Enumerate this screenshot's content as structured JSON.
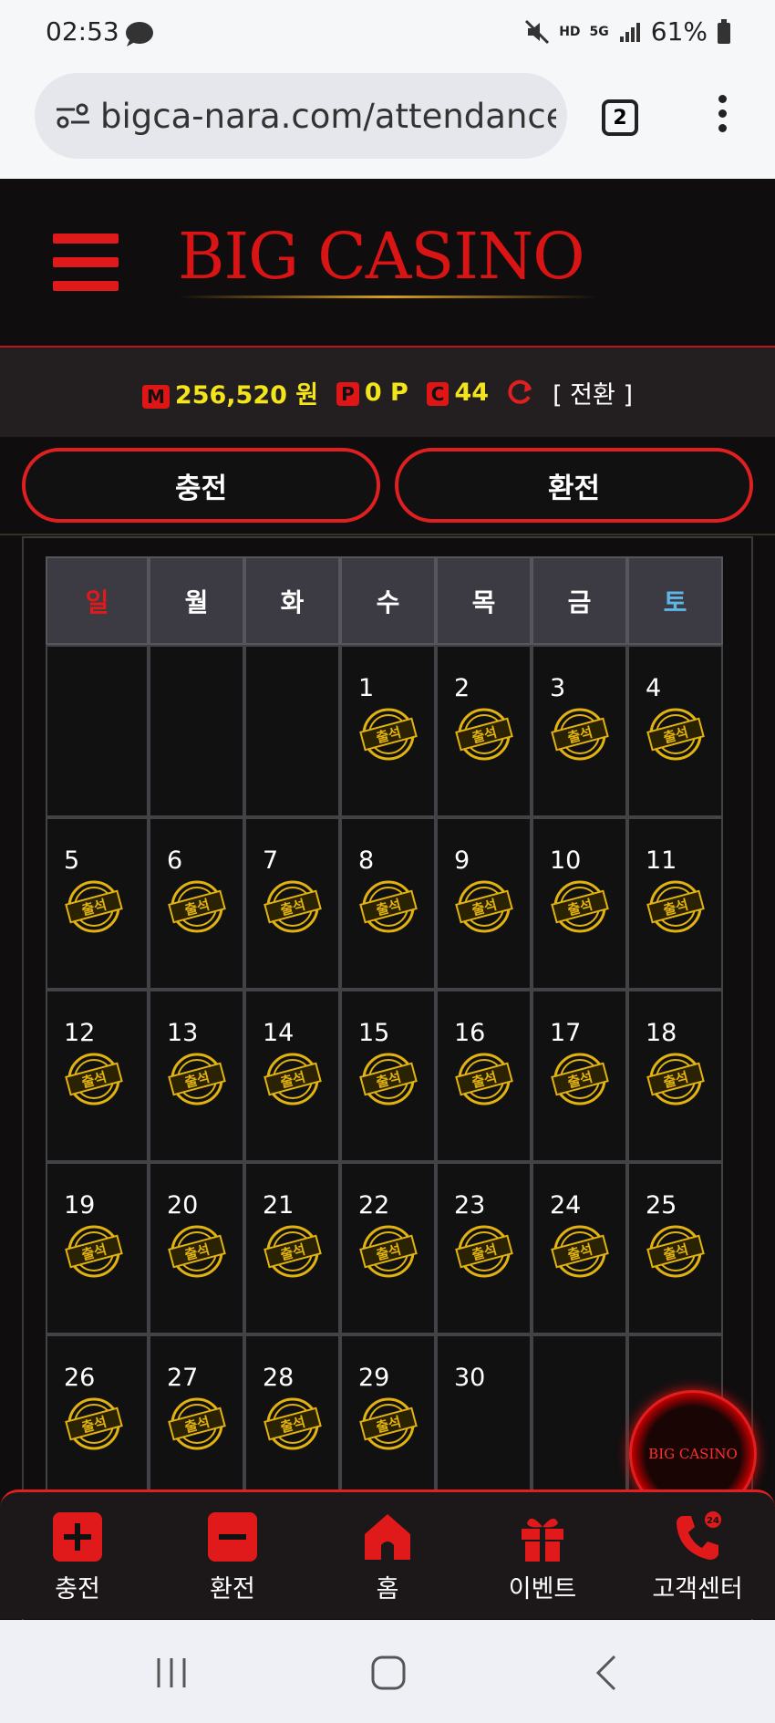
{
  "status_bar": {
    "time": "02:53",
    "battery": "61%",
    "network": "5G",
    "hd_label": "HD"
  },
  "browser": {
    "url": "bigca-nara.com/attendance2",
    "tab_count": "2"
  },
  "site": {
    "logo": "BIG CASINO",
    "balance": {
      "money_badge": "M",
      "money": "256,520 원",
      "point_badge": "P",
      "point": "0 P",
      "comp_badge": "C",
      "comp": "44",
      "convert": "[ 전환 ]"
    },
    "buttons": {
      "charge": "충전",
      "exchange": "환전"
    },
    "calendar": {
      "weekdays": [
        "일",
        "월",
        "화",
        "수",
        "목",
        "금",
        "토"
      ],
      "weekday_colors": {
        "sun": "#e01a1a",
        "sat": "#5fb6e6",
        "default": "#ffffff"
      },
      "stamp_label": "출석",
      "weeks": [
        [
          {
            "day": ""
          },
          {
            "day": ""
          },
          {
            "day": ""
          },
          {
            "day": "1",
            "stamp": true
          },
          {
            "day": "2",
            "stamp": true
          },
          {
            "day": "3",
            "stamp": true
          },
          {
            "day": "4",
            "stamp": true
          }
        ],
        [
          {
            "day": "5",
            "stamp": true
          },
          {
            "day": "6",
            "stamp": true
          },
          {
            "day": "7",
            "stamp": true
          },
          {
            "day": "8",
            "stamp": true
          },
          {
            "day": "9",
            "stamp": true
          },
          {
            "day": "10",
            "stamp": true
          },
          {
            "day": "11",
            "stamp": true
          }
        ],
        [
          {
            "day": "12",
            "stamp": true
          },
          {
            "day": "13",
            "stamp": true
          },
          {
            "day": "14",
            "stamp": true
          },
          {
            "day": "15",
            "stamp": true
          },
          {
            "day": "16",
            "stamp": true
          },
          {
            "day": "17",
            "stamp": true
          },
          {
            "day": "18",
            "stamp": true
          }
        ],
        [
          {
            "day": "19",
            "stamp": true
          },
          {
            "day": "20",
            "stamp": true
          },
          {
            "day": "21",
            "stamp": true
          },
          {
            "day": "22",
            "stamp": true
          },
          {
            "day": "23",
            "stamp": true
          },
          {
            "day": "24",
            "stamp": true
          },
          {
            "day": "25",
            "stamp": true
          }
        ],
        [
          {
            "day": "26",
            "stamp": true
          },
          {
            "day": "27",
            "stamp": true
          },
          {
            "day": "28",
            "stamp": true
          },
          {
            "day": "29",
            "stamp": true
          },
          {
            "day": "30",
            "stamp": false
          },
          {
            "day": ""
          },
          {
            "day": ""
          }
        ]
      ]
    },
    "floating_logo": "BIG CASINO",
    "bottom_nav": [
      {
        "label": "충전",
        "icon": "plus-icon"
      },
      {
        "label": "환전",
        "icon": "minus-icon"
      },
      {
        "label": "홈",
        "icon": "home-icon"
      },
      {
        "label": "이벤트",
        "icon": "gift-icon"
      },
      {
        "label": "고객센터",
        "icon": "phone-24-icon"
      }
    ]
  }
}
